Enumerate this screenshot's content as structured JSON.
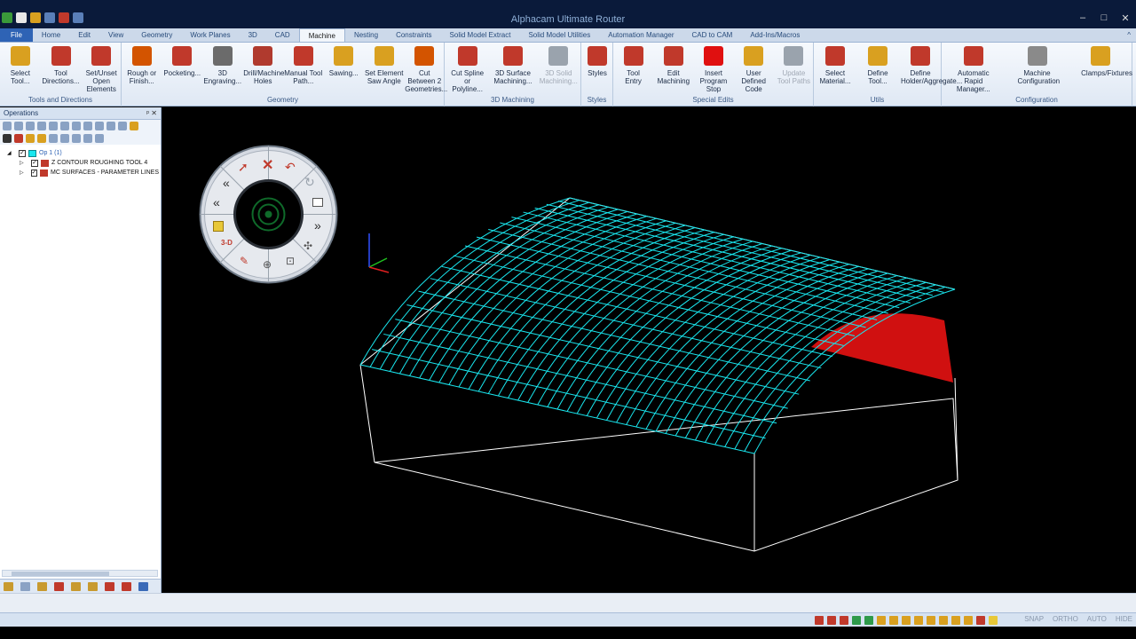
{
  "window": {
    "title": "Alphacam Ultimate Router",
    "controls": [
      "–",
      "□",
      "✕"
    ]
  },
  "tabs": [
    "File",
    "Home",
    "Edit",
    "View",
    "Geometry",
    "Work Planes",
    "3D",
    "CAD",
    "Machine",
    "Nesting",
    "Constraints",
    "Solid Model Extract",
    "Solid Model Utilities",
    "Automation Manager",
    "CAD to CAM",
    "Add-Ins/Macros"
  ],
  "active_tab": "Machine",
  "ribbon": {
    "groups": [
      {
        "label": "Tools and Directions",
        "buttons": [
          {
            "l1": "Select",
            "l2": "Tool...",
            "color": "#d9a020"
          },
          {
            "l1": "Tool",
            "l2": "Directions...",
            "color": "#c0392b"
          },
          {
            "l1": "Set/Unset",
            "l2": "Open Elements",
            "color": "#c0392b"
          }
        ]
      },
      {
        "label": "Geometry",
        "buttons": [
          {
            "l1": "Rough or",
            "l2": "Finish...",
            "color": "#d35400"
          },
          {
            "l1": "Pocketing...",
            "l2": "",
            "color": "#c0392b"
          },
          {
            "l1": "3D",
            "l2": "Engraving...",
            "color": "#6b6b6b"
          },
          {
            "l1": "Drill/Machine",
            "l2": "Holes",
            "color": "#b03a2e"
          },
          {
            "l1": "Manual Tool",
            "l2": "Path...",
            "color": "#c0392b"
          },
          {
            "l1": "Sawing...",
            "l2": "",
            "color": "#d9a020"
          },
          {
            "l1": "Set Element",
            "l2": "Saw Angle",
            "color": "#d9a020"
          },
          {
            "l1": "Cut Between 2",
            "l2": "Geometries...",
            "color": "#d35400"
          }
        ]
      },
      {
        "label": "3D Machining",
        "buttons": [
          {
            "l1": "Cut Spline or",
            "l2": "Polyline...",
            "color": "#c0392b"
          },
          {
            "l1": "3D Surface",
            "l2": "Machining...",
            "color": "#c0392b"
          },
          {
            "l1": "3D Solid",
            "l2": "Machining...",
            "color": "#9aa3ad",
            "disabled": true
          }
        ]
      },
      {
        "label": "Styles",
        "buttons": [
          {
            "l1": "Styles",
            "l2": "",
            "color": "#c0392b"
          }
        ]
      },
      {
        "label": "Special Edits",
        "buttons": [
          {
            "l1": "Tool",
            "l2": "Entry",
            "color": "#c0392b"
          },
          {
            "l1": "Edit",
            "l2": "Machining",
            "color": "#c0392b"
          },
          {
            "l1": "Insert",
            "l2": "Program Stop",
            "color": "#e01010"
          },
          {
            "l1": "User Defined",
            "l2": "Code",
            "color": "#d9a020"
          },
          {
            "l1": "Update",
            "l2": "Tool Paths",
            "color": "#9aa3ad",
            "disabled": true
          }
        ]
      },
      {
        "label": "Utils",
        "buttons": [
          {
            "l1": "Select",
            "l2": "Material...",
            "color": "#c0392b"
          },
          {
            "l1": "Define",
            "l2": "Tool...",
            "color": "#d9a020"
          },
          {
            "l1": "Define",
            "l2": "Holder/Aggregate...",
            "color": "#c0392b"
          }
        ]
      },
      {
        "label": "Configuration",
        "buttons": [
          {
            "l1": "Automatic Rapid",
            "l2": "Manager...",
            "color": "#c0392b"
          },
          {
            "l1": "Machine",
            "l2": "Configuration",
            "color": "#8a8a8a"
          },
          {
            "l1": "Clamps/Fixtures",
            "l2": "",
            "color": "#d9a020"
          }
        ]
      }
    ]
  },
  "operations_panel": {
    "title": "Operations",
    "pin": "ᵖ ✕",
    "tree": [
      {
        "label": "Op 1   (1)",
        "level": 0,
        "expand": "◢"
      },
      {
        "label": "Z CONTOUR ROUGHING   TOOL 4",
        "level": 1,
        "expand": "▷"
      },
      {
        "label": "MC SURFACES - PARAMETER LINES",
        "level": 1,
        "expand": "▷"
      }
    ]
  },
  "statusbar": {
    "flags": [
      "SNAP",
      "ORTHO",
      "AUTO",
      "HIDE"
    ]
  },
  "colors": {
    "toolpath": "#19e6ee",
    "surface": "#d01010",
    "wire": "#ffffff",
    "ribbon_bg": "#e4ecf6",
    "title_bg": "#0a1a3a"
  }
}
